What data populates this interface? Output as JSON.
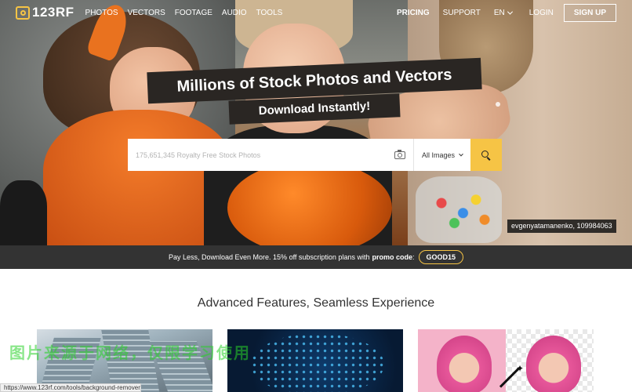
{
  "brand": {
    "logo_text": "123RF"
  },
  "nav": {
    "left": [
      "PHOTOS",
      "VECTORS",
      "FOOTAGE",
      "AUDIO",
      "TOOLS"
    ],
    "pricing": "PRICING",
    "support": "SUPPORT",
    "language": "EN",
    "login": "LOGIN",
    "signup": "SIGN UP"
  },
  "hero": {
    "headline": "Millions of Stock Photos and Vectors",
    "subline": "Download Instantly!",
    "credit": "evgenyatamanenko, 109984063"
  },
  "search": {
    "placeholder": "175,651,345 Royalty Free Stock Photos",
    "filter_selected": "All Images",
    "icons": [
      "camera-icon",
      "search-icon"
    ]
  },
  "promo": {
    "text": "Pay Less, Download Even More. 15% off subscription plans with",
    "label": "promo code",
    "colon": ":",
    "code": "GOOD15"
  },
  "features": {
    "title": "Advanced Features, Seamless Experience"
  },
  "overlay": {
    "watermark": "图片来源于网络，仅限学习使用",
    "status_url": "https://www.123rf.com/tools/background-remover/"
  },
  "colors": {
    "accent": "#f6c445",
    "promo_bar": "#333333",
    "headline_band": "#2a2623"
  }
}
